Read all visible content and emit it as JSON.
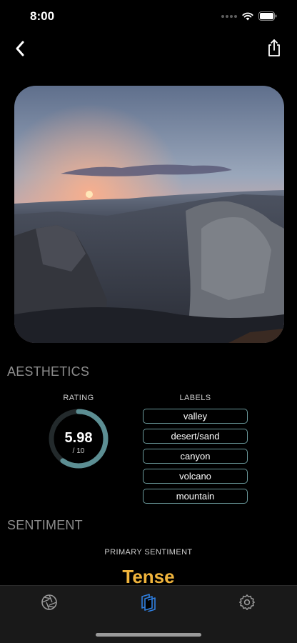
{
  "status_bar": {
    "time": "8:00"
  },
  "aesthetics": {
    "title": "AESTHETICS",
    "rating_header": "RATING",
    "rating_value": "5.98",
    "rating_scale": "/ 10",
    "rating_fraction": 0.598,
    "labels_header": "LABELS",
    "labels": [
      "valley",
      "desert/sand",
      "canyon",
      "volcano",
      "mountain"
    ]
  },
  "sentiment": {
    "title": "SENTIMENT",
    "primary_header": "PRIMARY SENTIMENT",
    "primary_value": "Tense"
  },
  "colors": {
    "accent_teal": "#5c8e93",
    "sentiment": "#f0b43c",
    "active_tab": "#2f7fe0"
  },
  "icons": {
    "back": "chevron-left-icon",
    "share": "share-icon",
    "tab_aperture": "aperture-icon",
    "tab_layers": "layers-icon",
    "tab_settings": "gear-icon"
  }
}
